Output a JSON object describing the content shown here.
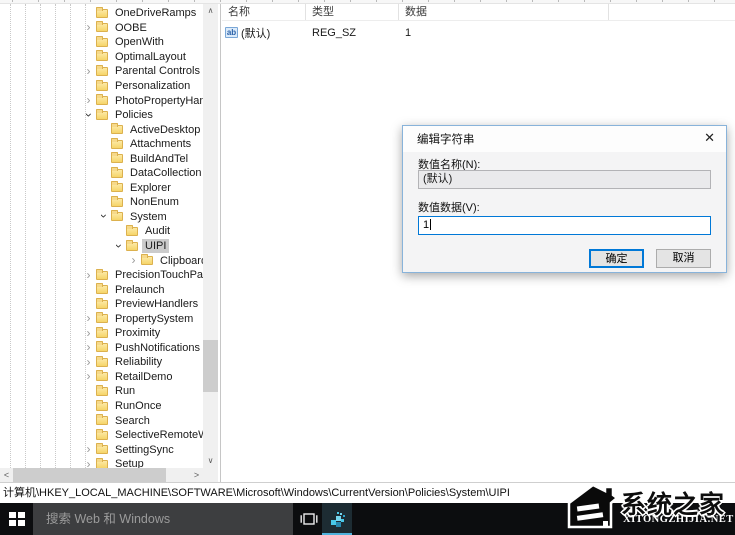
{
  "tree": {
    "items": [
      {
        "label": "OneDriveRamps",
        "level": 0,
        "expander": "none"
      },
      {
        "label": "OOBE",
        "level": 0,
        "expander": "collapsed"
      },
      {
        "label": "OpenWith",
        "level": 0,
        "expander": "none"
      },
      {
        "label": "OptimalLayout",
        "level": 0,
        "expander": "none"
      },
      {
        "label": "Parental Controls",
        "level": 0,
        "expander": "collapsed"
      },
      {
        "label": "Personalization",
        "level": 0,
        "expander": "none"
      },
      {
        "label": "PhotoPropertyHandle",
        "level": 0,
        "expander": "collapsed"
      },
      {
        "label": "Policies",
        "level": 0,
        "expander": "expanded"
      },
      {
        "label": "ActiveDesktop",
        "level": 1,
        "expander": "none"
      },
      {
        "label": "Attachments",
        "level": 1,
        "expander": "none"
      },
      {
        "label": "BuildAndTel",
        "level": 1,
        "expander": "none"
      },
      {
        "label": "DataCollection",
        "level": 1,
        "expander": "none"
      },
      {
        "label": "Explorer",
        "level": 1,
        "expander": "none"
      },
      {
        "label": "NonEnum",
        "level": 1,
        "expander": "none"
      },
      {
        "label": "System",
        "level": 1,
        "expander": "expanded"
      },
      {
        "label": "Audit",
        "level": 2,
        "expander": "none"
      },
      {
        "label": "UIPI",
        "level": 2,
        "expander": "expanded",
        "selected": true
      },
      {
        "label": "Clipboard",
        "level": 3,
        "expander": "collapsed"
      },
      {
        "label": "PrecisionTouchPad",
        "level": 0,
        "expander": "collapsed"
      },
      {
        "label": "Prelaunch",
        "level": 0,
        "expander": "none"
      },
      {
        "label": "PreviewHandlers",
        "level": 0,
        "expander": "none"
      },
      {
        "label": "PropertySystem",
        "level": 0,
        "expander": "collapsed"
      },
      {
        "label": "Proximity",
        "level": 0,
        "expander": "collapsed"
      },
      {
        "label": "PushNotifications",
        "level": 0,
        "expander": "collapsed"
      },
      {
        "label": "Reliability",
        "level": 0,
        "expander": "collapsed"
      },
      {
        "label": "RetailDemo",
        "level": 0,
        "expander": "collapsed"
      },
      {
        "label": "Run",
        "level": 0,
        "expander": "none"
      },
      {
        "label": "RunOnce",
        "level": 0,
        "expander": "none"
      },
      {
        "label": "Search",
        "level": 0,
        "expander": "none"
      },
      {
        "label": "SelectiveRemoteWipe",
        "level": 0,
        "expander": "none"
      },
      {
        "label": "SettingSync",
        "level": 0,
        "expander": "collapsed"
      },
      {
        "label": "Setup",
        "level": 0,
        "expander": "collapsed"
      }
    ]
  },
  "list": {
    "columns": [
      "名称",
      "类型",
      "数据"
    ],
    "rows": [
      {
        "name": "(默认)",
        "type": "REG_SZ",
        "data": "1"
      }
    ]
  },
  "status_bar": {
    "path": "计算机\\HKEY_LOCAL_MACHINE\\SOFTWARE\\Microsoft\\Windows\\CurrentVersion\\Policies\\System\\UIPI"
  },
  "dialog": {
    "title": "编辑字符串",
    "close_glyph": "✕",
    "name_label": "数值名称(N):",
    "name_value": "(默认)",
    "data_label": "数值数据(V):",
    "data_value": "1",
    "ok_label": "确定",
    "cancel_label": "取消"
  },
  "taskbar": {
    "search_placeholder": "搜索 Web 和 Windows"
  },
  "watermark": {
    "title": "系统之家",
    "domain": "XITONGZHIJIA.NET"
  },
  "icons": {
    "scroll_up": "∧",
    "scroll_down": "∨",
    "scroll_left": "<",
    "scroll_right": ">"
  },
  "colors": {
    "accent": "#0078d7",
    "selection_gray": "#cbcbcb",
    "folder_yellow": "#f6d469",
    "taskbar_black": "#0c0d0f",
    "active_app_underline": "#4fb2dc",
    "dialog_border_blue": "#88b3da"
  }
}
